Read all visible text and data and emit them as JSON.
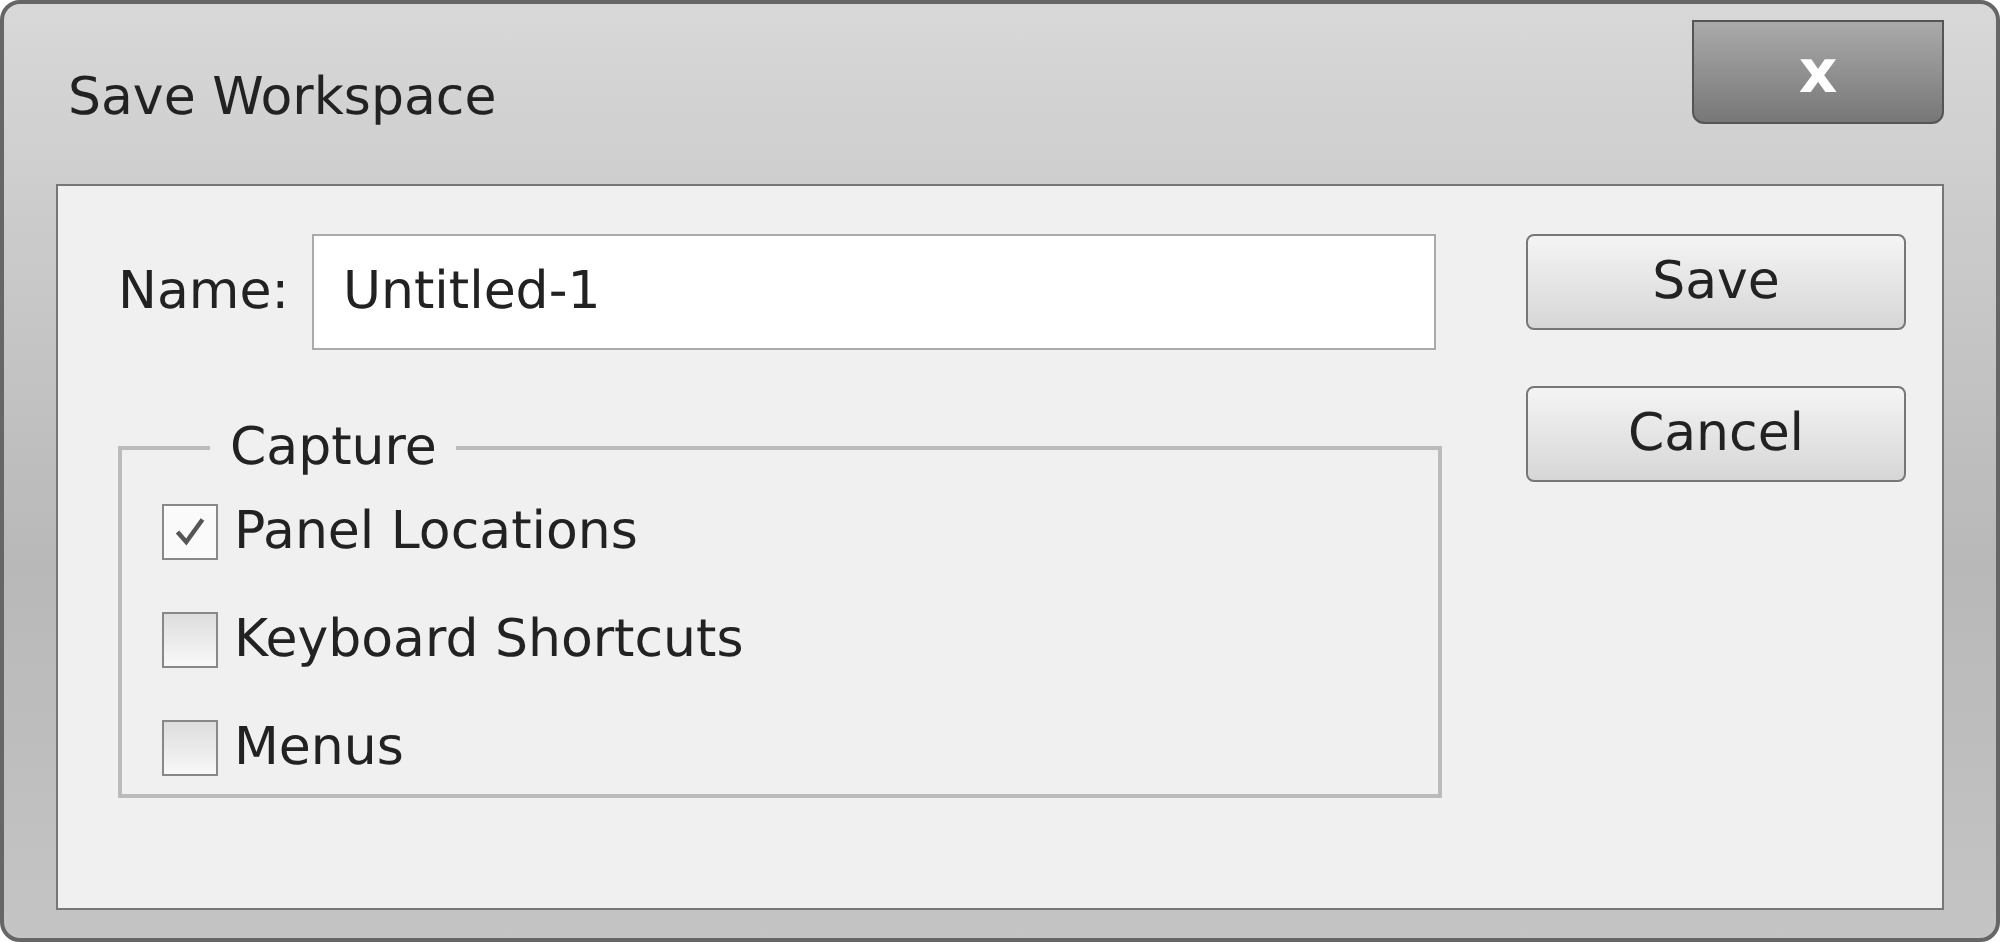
{
  "window": {
    "title": "Save Workspace",
    "close": "x"
  },
  "name_field": {
    "label": "Name:",
    "value": "Untitled-1"
  },
  "capture": {
    "legend": "Capture",
    "options": [
      {
        "label": "Panel Locations",
        "checked": true
      },
      {
        "label": "Keyboard Shortcuts",
        "checked": false
      },
      {
        "label": "Menus",
        "checked": false
      }
    ]
  },
  "buttons": [
    "Save",
    "Cancel"
  ]
}
